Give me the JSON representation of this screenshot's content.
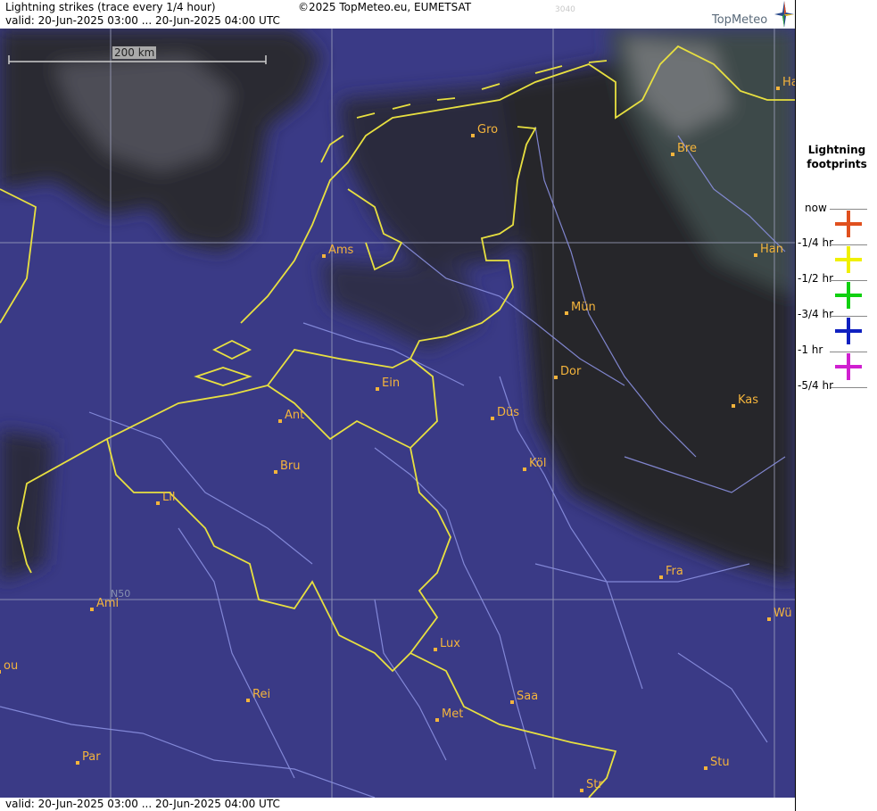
{
  "header": {
    "title": "Lightning strikes (trace every 1/4 hour)",
    "valid": "valid:  20-Jun-2025 03:00 ... 20-Jun-2025 04:00 UTC",
    "copyright": "©2025 TopMeteo.eu, EUMETSAT",
    "code": "3040",
    "logo": "TopMeteo"
  },
  "map": {
    "scale_label": "200 km",
    "grid_label": "N50",
    "cities": [
      {
        "id": "ham",
        "label": "Ha"
      },
      {
        "id": "gro",
        "label": "Gro"
      },
      {
        "id": "bre",
        "label": "Bre"
      },
      {
        "id": "ams",
        "label": "Ams"
      },
      {
        "id": "han",
        "label": "Han"
      },
      {
        "id": "mun",
        "label": "Mün"
      },
      {
        "id": "dor",
        "label": "Dor"
      },
      {
        "id": "ein",
        "label": "Ein"
      },
      {
        "id": "ant",
        "label": "Ant"
      },
      {
        "id": "dus",
        "label": "Düs"
      },
      {
        "id": "kas",
        "label": "Kas"
      },
      {
        "id": "kol",
        "label": "Köl"
      },
      {
        "id": "bru",
        "label": "Bru"
      },
      {
        "id": "lil",
        "label": "Lil"
      },
      {
        "id": "fra",
        "label": "Fra"
      },
      {
        "id": "ami",
        "label": "Ami"
      },
      {
        "id": "wur",
        "label": "Wü"
      },
      {
        "id": "lux",
        "label": "Lux"
      },
      {
        "id": "bou",
        "label": "ou"
      },
      {
        "id": "rei",
        "label": "Rei"
      },
      {
        "id": "saa",
        "label": "Saa"
      },
      {
        "id": "met",
        "label": "Met"
      },
      {
        "id": "par",
        "label": "Par"
      },
      {
        "id": "stu",
        "label": "Stu"
      },
      {
        "id": "str",
        "label": "Str"
      }
    ]
  },
  "footer": {
    "valid": "valid:  20-Jun-2025 03:00 ... 20-Jun-2025 04:00 UTC"
  },
  "legend": {
    "title": "Lightning footprints",
    "rows": [
      {
        "label": "now",
        "end_label": "-1/4 hr",
        "color": "#e0501e"
      },
      {
        "label": "-1/4 hr",
        "end_label": "-1/2 hr",
        "color": "#f0f000"
      },
      {
        "label": "-1/2 hr",
        "end_label": "-3/4 hr",
        "color": "#10d010"
      },
      {
        "label": "-3/4 hr",
        "end_label": "-1 hr",
        "color": "#1020c0"
      },
      {
        "label": "-1 hr",
        "end_label": "-5/4 hr",
        "color": "#d020d0"
      }
    ]
  }
}
